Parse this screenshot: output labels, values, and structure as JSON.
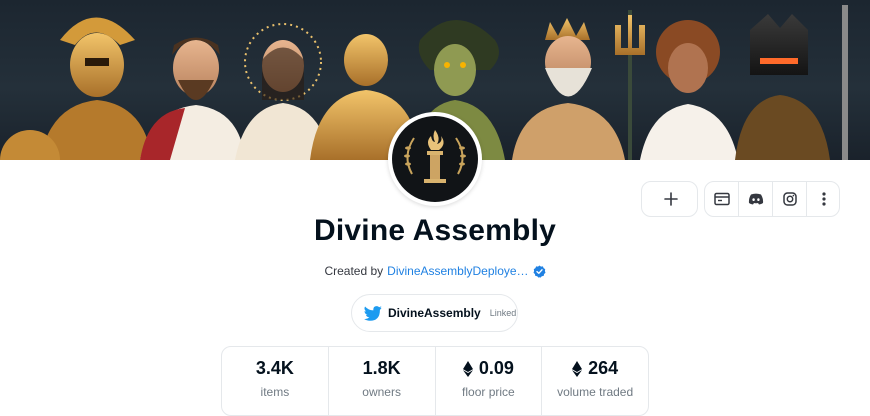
{
  "collection": {
    "name": "Divine Assembly",
    "created_by_label": "Created by",
    "creator": "DivineAssemblyDeploye…",
    "verified_icon": "verified-badge-icon",
    "accent_color": "#2081e2"
  },
  "actions": {
    "add_icon": "plus-icon",
    "website_icon": "website-icon",
    "discord_icon": "discord-icon",
    "instagram_icon": "instagram-icon",
    "more_icon": "more-vertical-icon"
  },
  "twitter": {
    "handle": "DivineAssembly",
    "linked_label": "Linked",
    "icon": "twitter-icon",
    "color": "#1d9bf0"
  },
  "stats": [
    {
      "value": "3.4K",
      "label": "items",
      "eth": false
    },
    {
      "value": "1.8K",
      "label": "owners",
      "eth": false
    },
    {
      "value": "0.09",
      "label": "floor price",
      "eth": true
    },
    {
      "value": "264",
      "label": "volume traded",
      "eth": true
    }
  ]
}
